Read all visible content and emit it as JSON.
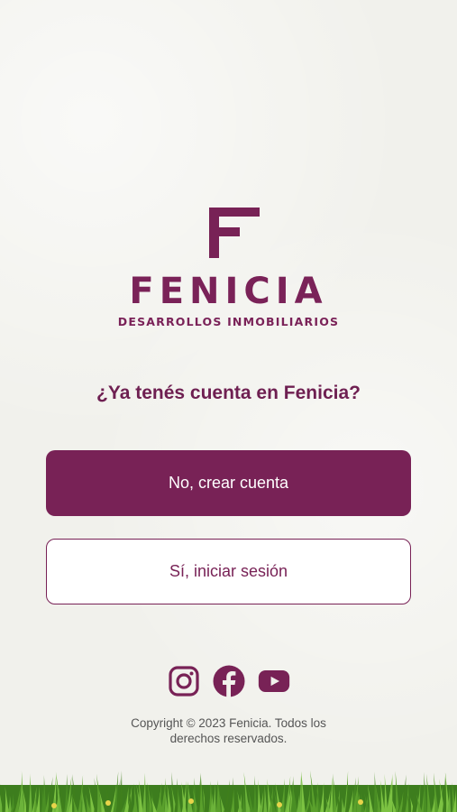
{
  "brand": {
    "name": "FENICIA",
    "tagline": "DESARROLLOS INMOBILIARIOS",
    "color": "#782256"
  },
  "prompt": {
    "question": "¿Ya tenés cuenta en Fenicia?"
  },
  "actions": {
    "create_account_label": "No, crear cuenta",
    "login_label": "Sí, iniciar sesión"
  },
  "socials": {
    "icons": [
      "instagram-icon",
      "facebook-icon",
      "youtube-icon"
    ]
  },
  "footer": {
    "line1": "Copyright © 2023 Fenicia. Todos los",
    "line2": "derechos reservados."
  }
}
